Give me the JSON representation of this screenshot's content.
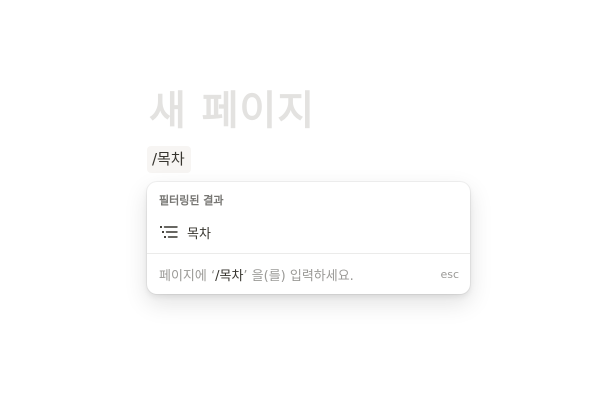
{
  "page": {
    "title": "새 페이지"
  },
  "editor": {
    "slash_command": "/목차"
  },
  "menu": {
    "section_title": "필터링된 결과",
    "items": [
      {
        "label": "목차",
        "icon": "table-of-contents-icon"
      }
    ],
    "footer": {
      "prefix": "페이지에 ‘",
      "query": "/목차",
      "suffix": "’ 을(를) 입력하세요."
    },
    "esc_label": "esc"
  },
  "colors": {
    "title_placeholder": "#e3e2e0",
    "text": "#37352f",
    "muted": "#9b9a97",
    "chip_bg": "#f7f5f3"
  }
}
